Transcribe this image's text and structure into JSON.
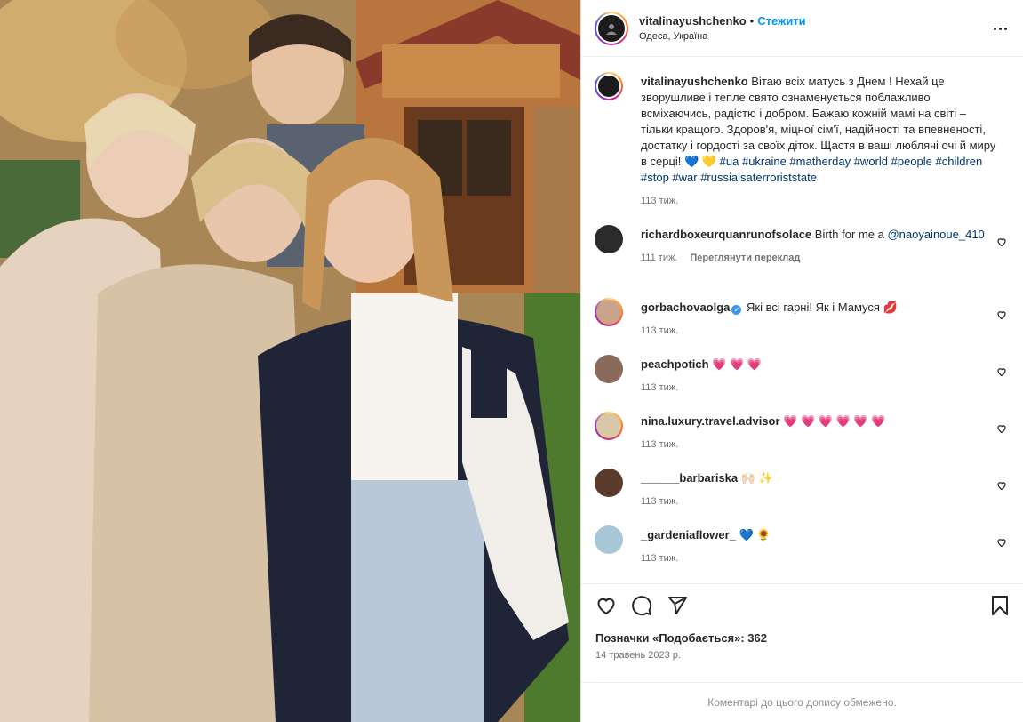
{
  "post": {
    "username": "vitalinayushchenko",
    "separator": "•",
    "follow_label": "Стежити",
    "location": "Одеса, Україна"
  },
  "caption": {
    "username": "vitalinayushchenko",
    "text": "Вітаю всіх матусь з Днем ! Нехай це зворушливе і тепле свято ознаменується поблажливо всміхаючись, радістю і добром. Бажаю кожній мамі на світі – тільки кращого. Здоров'я, міцної сім'ї, надійності та впевненості, достатку і гордості за своїх діток. Щастя в ваші люблячі очі й миру в серці! 💙 💛",
    "hashtags": "#ua #ukraine #matherday #world #people #children #stop #war #russiaisaterroriststate",
    "time": "113 тиж."
  },
  "comments": [
    {
      "username": "richardboxeurquanrunofsolace",
      "text": "Birth for me a",
      "mention": "@naoyainoue_410",
      "time": "111 тиж.",
      "translate": "Переглянути переклад",
      "avatar_color": "#2b2b2b"
    },
    {
      "username": "gorbachovaolga",
      "verified": "✓",
      "text": "Які всі гарні! Як і Мамуся 💋",
      "time": "113 тиж.",
      "avatar_color": "#c9a48a"
    },
    {
      "username": "peachpotich",
      "text": "💗 💗 💗",
      "time": "113 тиж.",
      "avatar_color": "#8a6a5a"
    },
    {
      "username": "nina.luxury.travel.advisor",
      "text": "💗 💗 💗 💗 💗 💗",
      "time": "113 тиж.",
      "avatar_color": "#d8c8a8"
    },
    {
      "username": "______barbariska",
      "text": "🙌🏻 ✨",
      "time": "113 тиж.",
      "avatar_color": "#5a3a2a"
    },
    {
      "username": "_gardeniaflower_",
      "text": "💙 🌻",
      "time": "113 тиж.",
      "avatar_color": "#a8c8d8"
    }
  ],
  "actions": {
    "icons": [
      "heart-icon",
      "comment-icon",
      "share-icon",
      "bookmark-icon"
    ],
    "likes": "Позначки «Подобається»: 362",
    "date": "14 травень 2023 р.",
    "comments_limited": "Коментарі до цього допису обмежено."
  },
  "colors": {
    "accent": "#0095f6",
    "link": "#00376b",
    "muted": "#737373",
    "text": "#262626"
  }
}
